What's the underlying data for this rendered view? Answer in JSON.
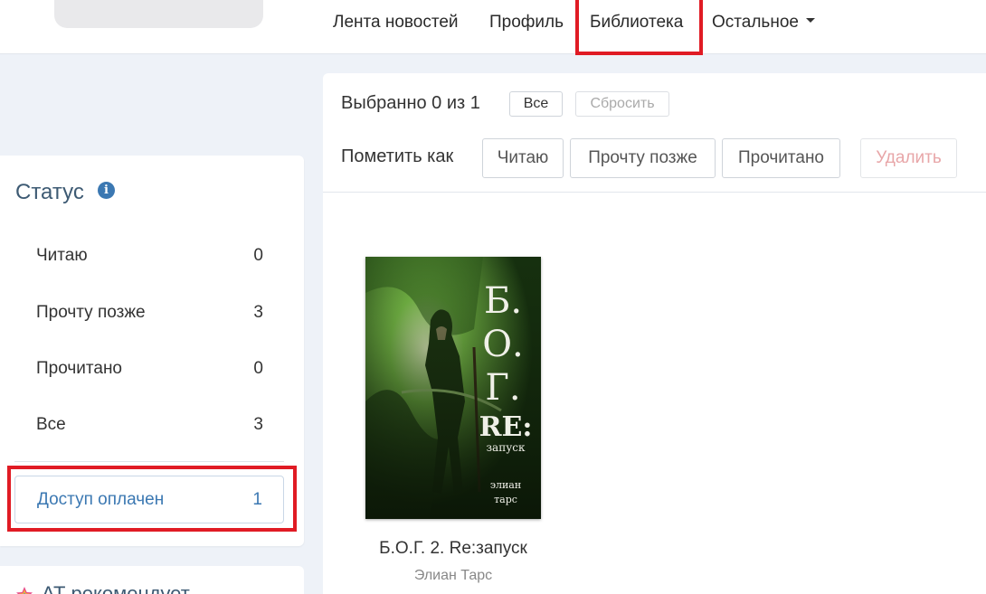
{
  "nav": {
    "items": [
      {
        "label": "Лента новостей"
      },
      {
        "label": "Профиль"
      },
      {
        "label": "Библиотека"
      },
      {
        "label": "Остальное"
      }
    ]
  },
  "sidebar": {
    "title": "Статус",
    "items": [
      {
        "label": "Читаю",
        "count": "0"
      },
      {
        "label": "Прочту позже",
        "count": "3"
      },
      {
        "label": "Прочитано",
        "count": "0"
      },
      {
        "label": "Все",
        "count": "3"
      },
      {
        "label": "Доступ оплачен",
        "count": "1"
      }
    ]
  },
  "recommend": {
    "title": "АТ рекомендует"
  },
  "selection": {
    "text": "Выбранно 0 из 1",
    "all_label": "Все",
    "reset_label": "Сбросить"
  },
  "mark": {
    "label": "Пометить как",
    "buttons": {
      "reading": "Читаю",
      "later": "Прочту позже",
      "read": "Прочитано",
      "delete": "Удалить"
    }
  },
  "books": [
    {
      "title": "Б.О.Г. 2. Re:запуск",
      "author": "Элиан Тарс",
      "cover_title": "Б.О.Г.",
      "cover_sub": "RE:",
      "cover_sub2": "запуск",
      "cover_author_line1": "элиан",
      "cover_author_line2": "тарс"
    }
  ],
  "colors": {
    "accent": "#3b78b2",
    "highlight": "#e01b24",
    "background": "#eef2f8"
  },
  "icons": {
    "info": "info-icon",
    "caret": "caret-down-icon",
    "recommend": "star-icon"
  }
}
